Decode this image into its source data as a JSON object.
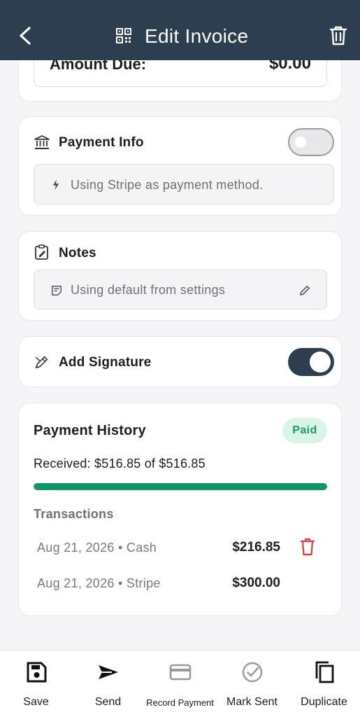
{
  "header": {
    "title": "Edit Invoice"
  },
  "amount_due": {
    "label": "Amount Due:",
    "value": "$0.00"
  },
  "payment_info": {
    "label": "Payment Info",
    "enabled": false,
    "method_text": "Using Stripe as payment method."
  },
  "notes": {
    "label": "Notes",
    "default_text": "Using default from settings"
  },
  "signature": {
    "label": "Add Signature",
    "enabled": true
  },
  "payment_history": {
    "title": "Payment History",
    "status": "Paid",
    "received_text": "Received: $516.85 of $516.85",
    "progress_percent": 100,
    "transactions_label": "Transactions",
    "transactions": [
      {
        "date": "Aug 21, 2026 • Cash",
        "amount": "$216.85",
        "deletable": true
      },
      {
        "date": "Aug 21, 2026 • Stripe",
        "amount": "$300.00",
        "deletable": false
      }
    ]
  },
  "bottom_bar": {
    "items": [
      {
        "label": "Save",
        "icon": "save-icon"
      },
      {
        "label": "Send",
        "icon": "send-icon"
      },
      {
        "label": "Record Payment",
        "icon": "card-icon",
        "disabled": true
      },
      {
        "label": "Mark Sent",
        "icon": "check-circle-icon",
        "disabled": true
      },
      {
        "label": "Duplicate",
        "icon": "duplicate-icon"
      }
    ]
  },
  "colors": {
    "header": "#2c3e50",
    "accent_green": "#0f9566",
    "danger": "#e53935"
  }
}
